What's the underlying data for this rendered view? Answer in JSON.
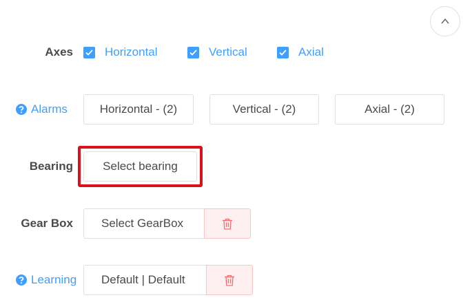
{
  "axes": {
    "label": "Axes",
    "options": [
      {
        "label": "Horizontal",
        "checked": true
      },
      {
        "label": "Vertical",
        "checked": true
      },
      {
        "label": "Axial",
        "checked": true
      }
    ]
  },
  "alarms": {
    "label": "Alarms",
    "buttons": [
      "Horizontal - (2)",
      "Vertical - (2)",
      "Axial - (2)"
    ]
  },
  "bearing": {
    "label": "Bearing",
    "button": "Select bearing"
  },
  "gearbox": {
    "label": "Gear Box",
    "button": "Select GearBox"
  },
  "learning": {
    "label": "Learning",
    "button": "Default | Default"
  },
  "icons": {
    "collapse": "chevron-up-icon",
    "check": "check-icon",
    "help": "question-circle-icon",
    "delete": "trash-icon"
  },
  "colors": {
    "accent": "#409eff",
    "danger_bg": "#fef0f0",
    "danger_icon": "#f56c6c",
    "highlight": "#d9121a"
  }
}
